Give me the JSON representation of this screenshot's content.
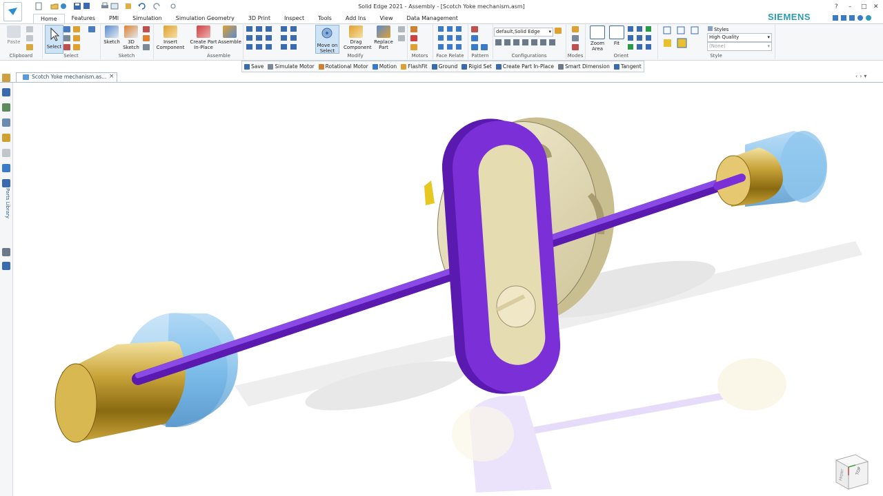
{
  "window": {
    "title": "Solid Edge 2021 - Assembly - [Scotch Yoke mechanism.asm]",
    "brand": "SIEMENS",
    "controls": [
      "?",
      "–",
      "□",
      "✕"
    ]
  },
  "tabs": [
    "Home",
    "Features",
    "PMI",
    "Simulation",
    "Simulation Geometry",
    "3D Print",
    "Inspect",
    "Tools",
    "Add Ins",
    "View",
    "Data Management"
  ],
  "active_tab": "Home",
  "ribbon": {
    "clipboard": {
      "label": "Clipboard",
      "paste": "Paste"
    },
    "select": {
      "label": "Select",
      "select": "Select"
    },
    "sketch": {
      "label": "Sketch",
      "sketch": "Sketch",
      "sketch3d": "3D Sketch"
    },
    "assemble": {
      "label": "Assemble",
      "insert": "Insert Component",
      "create_part": "Create Part In-Place",
      "assemble": "Assemble"
    },
    "modify": {
      "label": "Modify",
      "move_on_select": "Move on Select",
      "drag": "Drag Component",
      "replace": "Replace Part"
    },
    "motors": {
      "label": "Motors"
    },
    "face_relate": {
      "label": "Face Relate"
    },
    "pattern": {
      "label": "Pattern"
    },
    "configurations": {
      "label": "Configurations",
      "combo": "default,Solid Edge"
    },
    "modes": {
      "label": "Modes"
    },
    "orient": {
      "label": "Orient",
      "zoom_area": "Zoom Area",
      "fit": "Fit"
    },
    "style": {
      "label": "Style",
      "styles": "Styles",
      "quality": "High Quality",
      "none": "(None)"
    }
  },
  "command_bar": [
    "Save",
    "Simulate Motor",
    "Rotational Motor",
    "Motion",
    "FlashFit",
    "Ground",
    "Rigid Set",
    "Create Part In-Place",
    "Smart Dimension",
    "Tangent"
  ],
  "document": {
    "tab_label": "Scotch Yoke mechanism.as...",
    "close": "×"
  },
  "sidebar": {
    "parts_library": "Parts Library"
  },
  "viewcube": {
    "top": "TOP",
    "front": "FRONT",
    "right": "RIGHT"
  },
  "colors": {
    "accent": "#2a9bb2",
    "yoke": "#7b2fd6",
    "brass": "#c9a43a",
    "transparent_blue": "#6fb6e8",
    "disc": "#e4dcb8"
  }
}
